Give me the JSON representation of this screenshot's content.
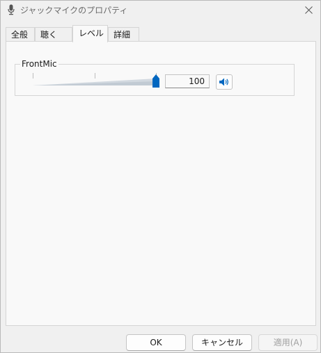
{
  "window": {
    "title": "ジャックマイクのプロパティ",
    "title_icon": "microphone-icon",
    "close_icon": "close-icon"
  },
  "tabs": [
    {
      "label": "全般",
      "active": false
    },
    {
      "label": "聴く",
      "active": false
    },
    {
      "label": "レベル",
      "active": true
    },
    {
      "label": "詳細",
      "active": false
    }
  ],
  "level_group": {
    "label": "FrontMic",
    "slider_level": 100,
    "value": "100",
    "mute_icon": "speaker-icon"
  },
  "buttons": {
    "ok": "OK",
    "cancel": "キャンセル",
    "apply": "適用(A)"
  },
  "colors": {
    "accent": "#0067c0",
    "panel": "#f9f9f9",
    "window": "#f0f0f0"
  }
}
